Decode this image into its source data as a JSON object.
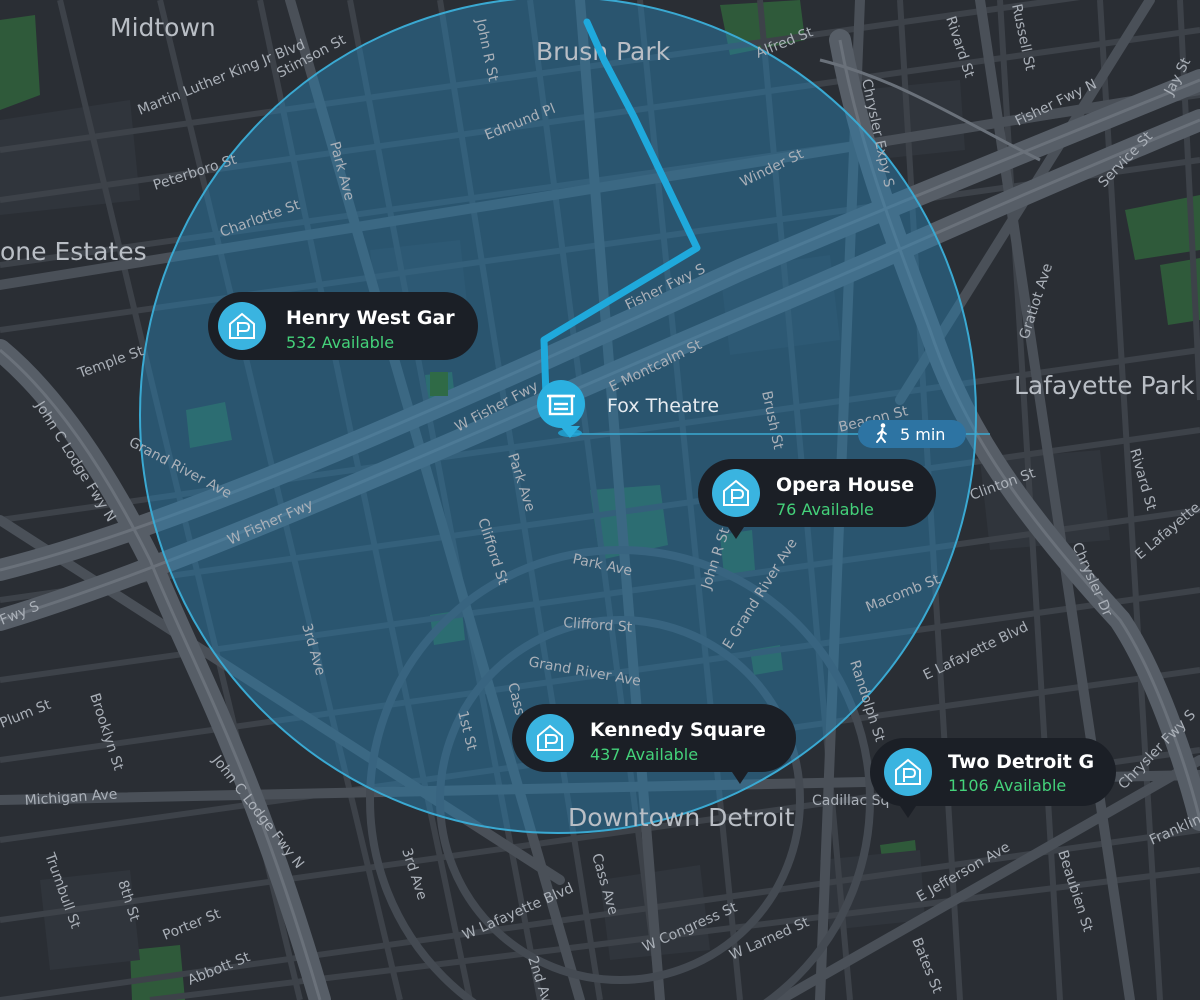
{
  "map": {
    "areas": [
      "Midtown",
      "Brush Park",
      "one Estates",
      "Lafayette Park",
      "Downtown Detroit"
    ],
    "streets": [
      "Martin Luther King Jr Blvd",
      "Stimson St",
      "John R St",
      "Alfred St",
      "Edmund Pl",
      "Peterboro St",
      "Park Ave",
      "Charlotte St",
      "Chrysler Expy S",
      "Fisher Fwy N",
      "Winder St",
      "Fisher Fwy S",
      "E Montcalm St",
      "W Fisher Fwy",
      "Temple St",
      "Brush St",
      "Beacon St",
      "Grand River Ave",
      "W Fisher Fwy",
      "John C Lodge Fwy N",
      "Clifford St",
      "Park Ave",
      "John R St",
      "E Grand River Ave",
      "Macomb St",
      "Clinton St",
      "Rivard St",
      "Gratiot Ave",
      "Service St",
      "Jay St",
      "Russell St",
      "3rd Ave",
      "1st St",
      "Cass Ave",
      "Randolph St",
      "E Lafayette Blvd",
      "Cadillac Sq",
      "Michigan Ave",
      "Plum St",
      "Brooklyn St",
      "John C Lodge Fwy N",
      "Trumbull St",
      "8th St",
      "3rd Ave",
      "Cass Ave",
      "W Lafayette Blvd",
      "W Congress St",
      "W Larned St",
      "E Jefferson Ave",
      "Beaubien St",
      "Porter St",
      "Abbott St",
      "2nd Ave",
      "Bates St",
      "Chrysler Dr",
      "E Lafayette",
      "Franklin",
      "Fwy S",
      "Rivard St",
      "Chrysler Fwy S",
      "Clifford St",
      "Grand River Ave",
      "Park Ave"
    ]
  },
  "destination": {
    "name": "Fox Theatre",
    "icon": "theatre-icon",
    "walk_time": "5 min",
    "walk_icon": "walking-person-icon"
  },
  "garages": [
    {
      "name": "Henry West Gar",
      "availability": "532 Available",
      "icon": "parking-garage-icon"
    },
    {
      "name": "Opera House",
      "availability": "76 Available",
      "icon": "parking-garage-icon"
    },
    {
      "name": "Kennedy Square",
      "availability": "437 Available",
      "icon": "parking-garage-icon"
    },
    {
      "name": "Two Detroit G",
      "availability": "1106 Available",
      "icon": "parking-garage-icon"
    }
  ],
  "colors": {
    "background": "#2a2e34",
    "road": "#454b53",
    "route": "#1fa9dc",
    "radius_fill": "#2a86b8",
    "radius_stroke": "#3aa9d2",
    "card": "#1b1f26",
    "available": "#44d27a",
    "park": "#2f5a3a"
  }
}
